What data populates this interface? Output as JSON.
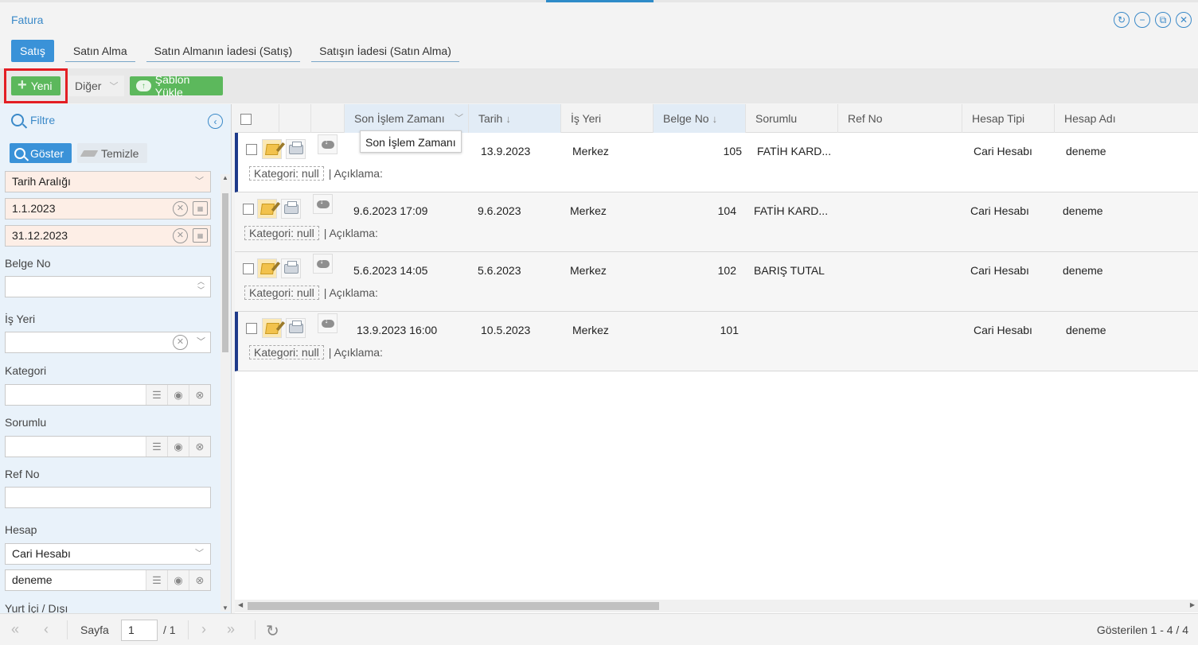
{
  "window": {
    "title": "Fatura",
    "controls": [
      "refresh-icon",
      "minimize-icon",
      "restore-icon",
      "close-icon"
    ]
  },
  "tabs": [
    {
      "label": "Satış",
      "active": true
    },
    {
      "label": "Satın Alma",
      "active": false
    },
    {
      "label": "Satın Almanın İadesi (Satış)",
      "active": false
    },
    {
      "label": "Satışın İadesi (Satın Alma)",
      "active": false
    }
  ],
  "toolbar": {
    "new_label": "Yeni",
    "other_label": "Diğer",
    "template_label": "Şablon Yükle"
  },
  "filter": {
    "title": "Filtre",
    "show_label": "Göster",
    "clear_label": "Temizle",
    "date_range": "Tarih Aralığı",
    "date_start": "1.1.2023",
    "date_end": "31.12.2023",
    "belge_no_label": "Belge No",
    "belge_no_value": "",
    "is_yeri_label": "İş Yeri",
    "is_yeri_value": "",
    "kategori_label": "Kategori",
    "kategori_value": "",
    "sorumlu_label": "Sorumlu",
    "sorumlu_value": "",
    "ref_no_label": "Ref No",
    "ref_no_value": "",
    "hesap_label": "Hesap",
    "hesap_type": "Cari Hesabı",
    "hesap_value": "deneme",
    "yurt_label": "Yurt İçi / Dışı"
  },
  "grid": {
    "columns": [
      "Son İşlem Zamanı",
      "Tarih",
      "İş Yeri",
      "Belge No",
      "Sorumlu",
      "Ref No",
      "Hesap Tipi",
      "Hesap Adı"
    ],
    "tooltip": "Son İşlem Zamanı",
    "rows": [
      {
        "son_islem": "",
        "tarih": "13.9.2023",
        "is_yeri": "Merkez",
        "belge_no": "105",
        "sorumlu": "FATİH KARD...",
        "ref_no": "",
        "hesap_tipi": "Cari Hesabı",
        "hesap_adi": "deneme",
        "kategori": "Kategori: null",
        "aciklama": "| Açıklama:"
      },
      {
        "son_islem": "9.6.2023 17:09",
        "tarih": "9.6.2023",
        "is_yeri": "Merkez",
        "belge_no": "104",
        "sorumlu": "FATİH KARD...",
        "ref_no": "",
        "hesap_tipi": "Cari Hesabı",
        "hesap_adi": "deneme",
        "kategori": "Kategori: null",
        "aciklama": "| Açıklama:"
      },
      {
        "son_islem": "5.6.2023 14:05",
        "tarih": "5.6.2023",
        "is_yeri": "Merkez",
        "belge_no": "102",
        "sorumlu": "BARIŞ TUTAL",
        "ref_no": "",
        "hesap_tipi": "Cari Hesabı",
        "hesap_adi": "deneme",
        "kategori": "Kategori: null",
        "aciklama": "| Açıklama:"
      },
      {
        "son_islem": "13.9.2023 16:00",
        "tarih": "10.5.2023",
        "is_yeri": "Merkez",
        "belge_no": "101",
        "sorumlu": "",
        "ref_no": "",
        "hesap_tipi": "Cari Hesabı",
        "hesap_adi": "deneme",
        "kategori": "Kategori: null",
        "aciklama": "| Açıklama:"
      }
    ]
  },
  "pager": {
    "page_label": "Sayfa",
    "page": "1",
    "total": "/ 1",
    "info": "Gösterilen 1 - 4 / 4"
  },
  "colors": {
    "accent": "#3a92d8",
    "green": "#5cb85c",
    "highlight": "#e31e24",
    "row_marker": "#1e3a8a"
  }
}
